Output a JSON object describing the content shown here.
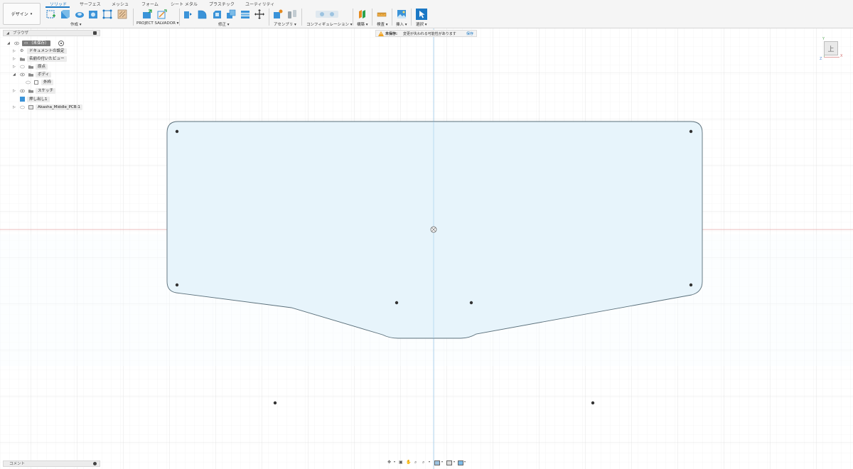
{
  "toolbar": {
    "workspace": "デザイン",
    "tabs": [
      "ソリッド",
      "サーフェス",
      "メッシュ",
      "フォーム",
      "シート メタル",
      "プラスチック",
      "ユーティリティ"
    ],
    "groups": {
      "create": "作成",
      "project": "PROJECT SALVADOR",
      "modify": "修正",
      "assemble": "アセンブリ",
      "configure": "コンフィギュレーション",
      "construct": "構築",
      "inspect": "検査",
      "insert": "挿入",
      "select": "選択"
    }
  },
  "browser": {
    "title": "ブラウザ",
    "root": "（未保存）",
    "items": {
      "doc_settings": "ドキュメントの設定",
      "named_views": "名前の付いたビュー",
      "origin": "原点",
      "bodies": "ボディ",
      "body1": "外枠",
      "sketches": "スケッチ",
      "extrude": "押し出し1",
      "component": "Akasha_Middle_PCB:1"
    }
  },
  "warning": {
    "label": "未保存:",
    "message": "変更が失われる可能性があります",
    "action": "保存"
  },
  "viewcube": {
    "face": "上",
    "axis_x": "X",
    "axis_y": "Y",
    "axis_z": "Z"
  },
  "comments": {
    "title": "コメント"
  },
  "colors": {
    "accent": "#1b78c5",
    "body_fill": "#e7f4fb",
    "body_edge": "#5a6f7a",
    "grid_minor": "#ececec",
    "grid_major": "#dcdcdc",
    "axis_red": "#e8a6a6",
    "axis_blue": "#9cc9ea",
    "warning": "#f0a11e"
  }
}
